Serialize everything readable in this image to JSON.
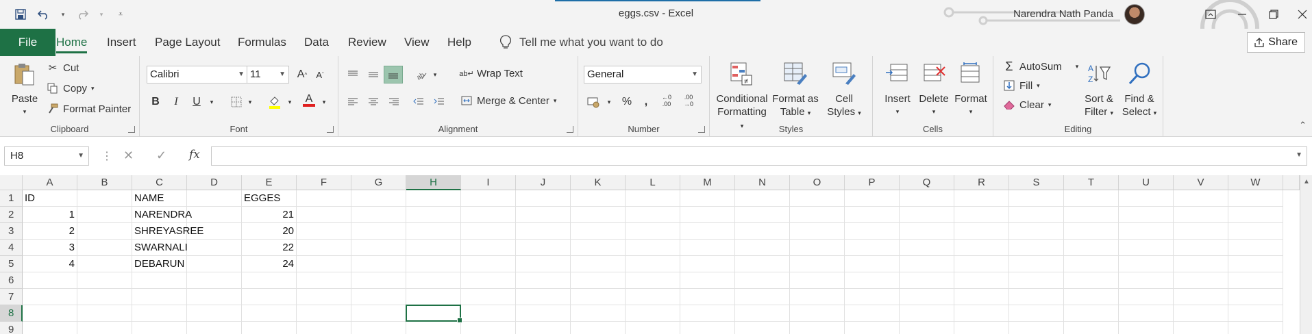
{
  "window": {
    "title": "eggs.csv  -  Excel",
    "user": "Narendra Nath Panda"
  },
  "menu": {
    "file": "File",
    "tabs": [
      "Home",
      "Insert",
      "Page Layout",
      "Formulas",
      "Data",
      "Review",
      "View",
      "Help"
    ],
    "tell_me": "Tell me what you want to do",
    "share": "Share"
  },
  "ribbon": {
    "clipboard": {
      "label": "Clipboard",
      "paste": "Paste",
      "cut": "Cut",
      "copy": "Copy",
      "format_painter": "Format Painter"
    },
    "font": {
      "label": "Font",
      "name": "Calibri",
      "size": "11",
      "bold": "B",
      "italic": "I",
      "underline": "U",
      "font_color_letter": "A"
    },
    "alignment": {
      "label": "Alignment",
      "wrap_text": "Wrap Text",
      "merge_center": "Merge & Center"
    },
    "number": {
      "label": "Number",
      "format": "General"
    },
    "styles": {
      "label": "Styles",
      "conditional_l1": "Conditional",
      "conditional_l2": "Formatting",
      "format_table_l1": "Format as",
      "format_table_l2": "Table",
      "cell_styles_l1": "Cell",
      "cell_styles_l2": "Styles"
    },
    "cells": {
      "label": "Cells",
      "insert": "Insert",
      "delete": "Delete",
      "format": "Format"
    },
    "editing": {
      "label": "Editing",
      "autosum": "AutoSum",
      "fill": "Fill",
      "clear": "Clear",
      "sort_l1": "Sort &",
      "sort_l2": "Filter",
      "find_l1": "Find &",
      "find_l2": "Select"
    }
  },
  "formula_bar": {
    "name_box": "H8",
    "fx": "fx",
    "content": ""
  },
  "sheet": {
    "columns": [
      "A",
      "B",
      "C",
      "D",
      "E",
      "F",
      "G",
      "H",
      "I",
      "J",
      "K",
      "L",
      "M",
      "N",
      "O",
      "P",
      "Q",
      "R",
      "S",
      "T",
      "U",
      "V",
      "W"
    ],
    "rows": [
      "1",
      "2",
      "3",
      "4",
      "5",
      "6",
      "7",
      "8",
      "9"
    ],
    "selected_col": "H",
    "selected_row": "8",
    "cells": {
      "A1": "ID",
      "C1": "NAME",
      "E1": "EGGES",
      "A2": "1",
      "C2": "NARENDRA",
      "E2": "21",
      "A3": "2",
      "C3": "SHREYASREE",
      "E3": "20",
      "A4": "3",
      "C4": "SWARNALI",
      "E4": "22",
      "A5": "4",
      "C5": "DEBARUN",
      "E5": "24"
    }
  }
}
